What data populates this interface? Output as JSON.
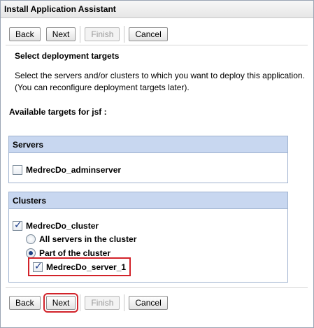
{
  "window": {
    "title": "Install Application Assistant"
  },
  "top_buttons": {
    "back": "Back",
    "next": "Next",
    "finish": "Finish",
    "cancel": "Cancel"
  },
  "bottom_buttons": {
    "back": "Back",
    "next": "Next",
    "finish": "Finish",
    "cancel": "Cancel"
  },
  "section": {
    "heading": "Select deployment targets",
    "description": "Select the servers and/or clusters to which you want to deploy this application. (You can reconfigure deployment targets later)."
  },
  "available_label": "Available targets for jsf :",
  "servers": {
    "header": "Servers",
    "items": [
      {
        "label": "MedrecDo_adminserver",
        "checked": false
      }
    ]
  },
  "clusters": {
    "header": "Clusters",
    "cluster": {
      "label": "MedrecDo_cluster",
      "checked": true
    },
    "options": [
      {
        "label": "All servers in the cluster",
        "selected": false
      },
      {
        "label": "Part of the cluster",
        "selected": true
      }
    ],
    "members": [
      {
        "label": "MedrecDo_server_1",
        "checked": true
      }
    ]
  },
  "colors": {
    "panel_header": "#c8d7f0",
    "highlight": "#d2232a"
  }
}
